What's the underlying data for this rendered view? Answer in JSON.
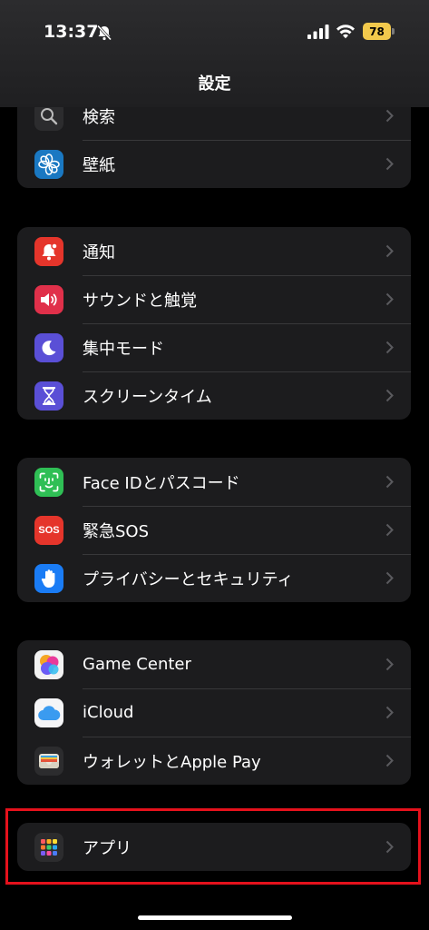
{
  "status": {
    "time": "13:37",
    "battery": "78"
  },
  "header": {
    "title": "設定"
  },
  "groups": [
    {
      "items": [
        {
          "label": "検索",
          "icon": "magnifier-icon"
        },
        {
          "label": "壁紙",
          "icon": "wallpaper-flower-icon"
        }
      ]
    },
    {
      "items": [
        {
          "label": "通知",
          "icon": "notification-bell-icon"
        },
        {
          "label": "サウンドと触覚",
          "icon": "speaker-icon"
        },
        {
          "label": "集中モード",
          "icon": "moon-icon"
        },
        {
          "label": "スクリーンタイム",
          "icon": "hourglass-icon"
        }
      ]
    },
    {
      "items": [
        {
          "label": "Face IDとパスコード",
          "icon": "face-id-icon"
        },
        {
          "label": "緊急SOS",
          "icon": "sos-icon",
          "badge_text": "SOS"
        },
        {
          "label": "プライバシーとセキュリティ",
          "icon": "hand-icon"
        }
      ]
    },
    {
      "items": [
        {
          "label": "Game Center",
          "icon": "game-center-icon"
        },
        {
          "label": "iCloud",
          "icon": "cloud-icon"
        },
        {
          "label": "ウォレットとApple Pay",
          "icon": "wallet-icon"
        }
      ]
    },
    {
      "items": [
        {
          "label": "アプリ",
          "icon": "apps-grid-icon"
        }
      ]
    }
  ],
  "colors": {
    "highlight": "#e5111c",
    "background": "#000000",
    "group": "#1c1c1e"
  }
}
